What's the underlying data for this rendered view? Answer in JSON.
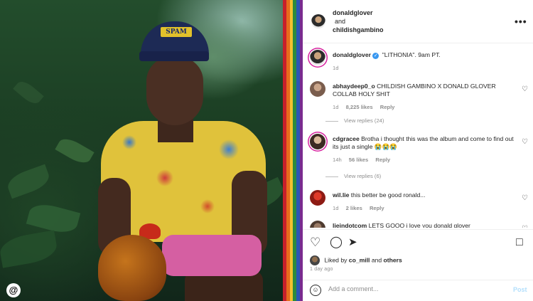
{
  "photo": {
    "cap_text": "SPAM",
    "threads_icon": "threads-icon"
  },
  "header": {
    "author1": "donaldglover",
    "connector": "and",
    "author2": "childishgambino",
    "more_icon": "more-options-icon"
  },
  "caption": {
    "username": "donaldglover",
    "verified_icon": "verified-badge-icon",
    "text": "\"LITHONIA\". 9am PT.",
    "time": "1d"
  },
  "comments": [
    {
      "username": "abhaydeep0_o",
      "text": "CHILDISH GAMBINO X DONALD GLOVER COLLAB HOLY SHIT",
      "time": "1d",
      "likes": "8,225 likes",
      "reply": "Reply",
      "view_replies": "View replies (24)"
    },
    {
      "username": "cdgracee",
      "text": "Brotha i thought this was the album and come to find out its just a single 😭😭😭",
      "time": "14h",
      "likes": "56 likes",
      "reply": "Reply",
      "view_replies": "View replies (6)"
    },
    {
      "username": "wil.lie",
      "text": "this better be good ronald...",
      "time": "1d",
      "likes": "2 likes",
      "reply": "Reply"
    },
    {
      "username": "lieindotcom",
      "text": "LETS GOOO i love you donald glover"
    }
  ],
  "actions": {
    "like_icon": "heart-icon",
    "comment_icon": "comment-icon",
    "share_icon": "share-icon",
    "save_icon": "bookmark-icon"
  },
  "likes": {
    "prefix": "Liked by",
    "user": "co_mill",
    "and": "and",
    "others": "others"
  },
  "time_ago": "1 day ago",
  "add_comment": {
    "placeholder": "Add a comment...",
    "post_label": "Post",
    "emoji_icon": "emoji-icon"
  }
}
